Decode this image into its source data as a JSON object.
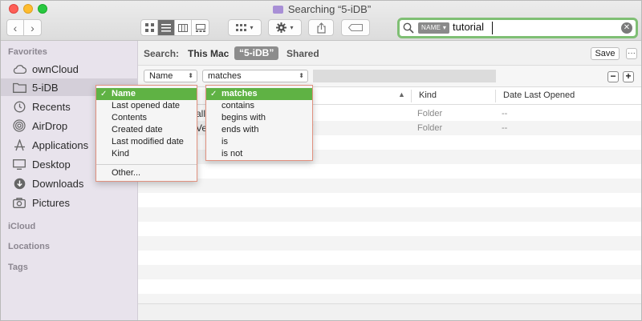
{
  "window": {
    "title": "Searching “5-iDB”"
  },
  "search": {
    "token": "NAME",
    "query": "tutorial"
  },
  "sidebar": {
    "favorites_heading": "Favorites",
    "items": [
      {
        "label": "ownCloud",
        "icon": "cloud-icon"
      },
      {
        "label": "5-iDB",
        "icon": "folder-icon",
        "selected": true
      },
      {
        "label": "Recents",
        "icon": "clock-icon"
      },
      {
        "label": "AirDrop",
        "icon": "airdrop-icon"
      },
      {
        "label": "Applications",
        "icon": "applications-icon"
      },
      {
        "label": "Desktop",
        "icon": "desktop-icon"
      },
      {
        "label": "Downloads",
        "icon": "downloads-icon"
      },
      {
        "label": "Pictures",
        "icon": "camera-icon"
      }
    ],
    "icloud_heading": "iCloud",
    "locations_heading": "Locations",
    "tags_heading": "Tags"
  },
  "scope": {
    "label": "Search:",
    "this_mac": "This Mac",
    "folder": "“5-iDB”",
    "shared": "Shared",
    "save_label": "Save",
    "more_label": "···"
  },
  "criteria": {
    "attribute": "Name",
    "operator": "matches",
    "remove_label": "−",
    "add_label": "+"
  },
  "columns": {
    "kind": "Kind",
    "date_last_opened": "Date Last Opened"
  },
  "rows": [
    {
      "name_fragment": "all",
      "kind": "Folder",
      "date": "--"
    },
    {
      "name_fragment": "Veb",
      "name_suffix": "7",
      "kind": "Folder",
      "date": "--"
    }
  ],
  "attribute_menu": {
    "items": [
      "Name",
      "Last opened date",
      "Contents",
      "Created date",
      "Last modified date",
      "Kind"
    ],
    "other": "Other...",
    "checked_index": 0
  },
  "operator_menu": {
    "items": [
      "matches",
      "contains",
      "begins with",
      "ends with",
      "is",
      "is not"
    ],
    "checked_index": 0
  },
  "colors": {
    "accent_green": "#5fb244",
    "search_ring": "#7fbf74",
    "menu_border": "#e1917f",
    "sidebar_bg": "#e8e3ec"
  }
}
